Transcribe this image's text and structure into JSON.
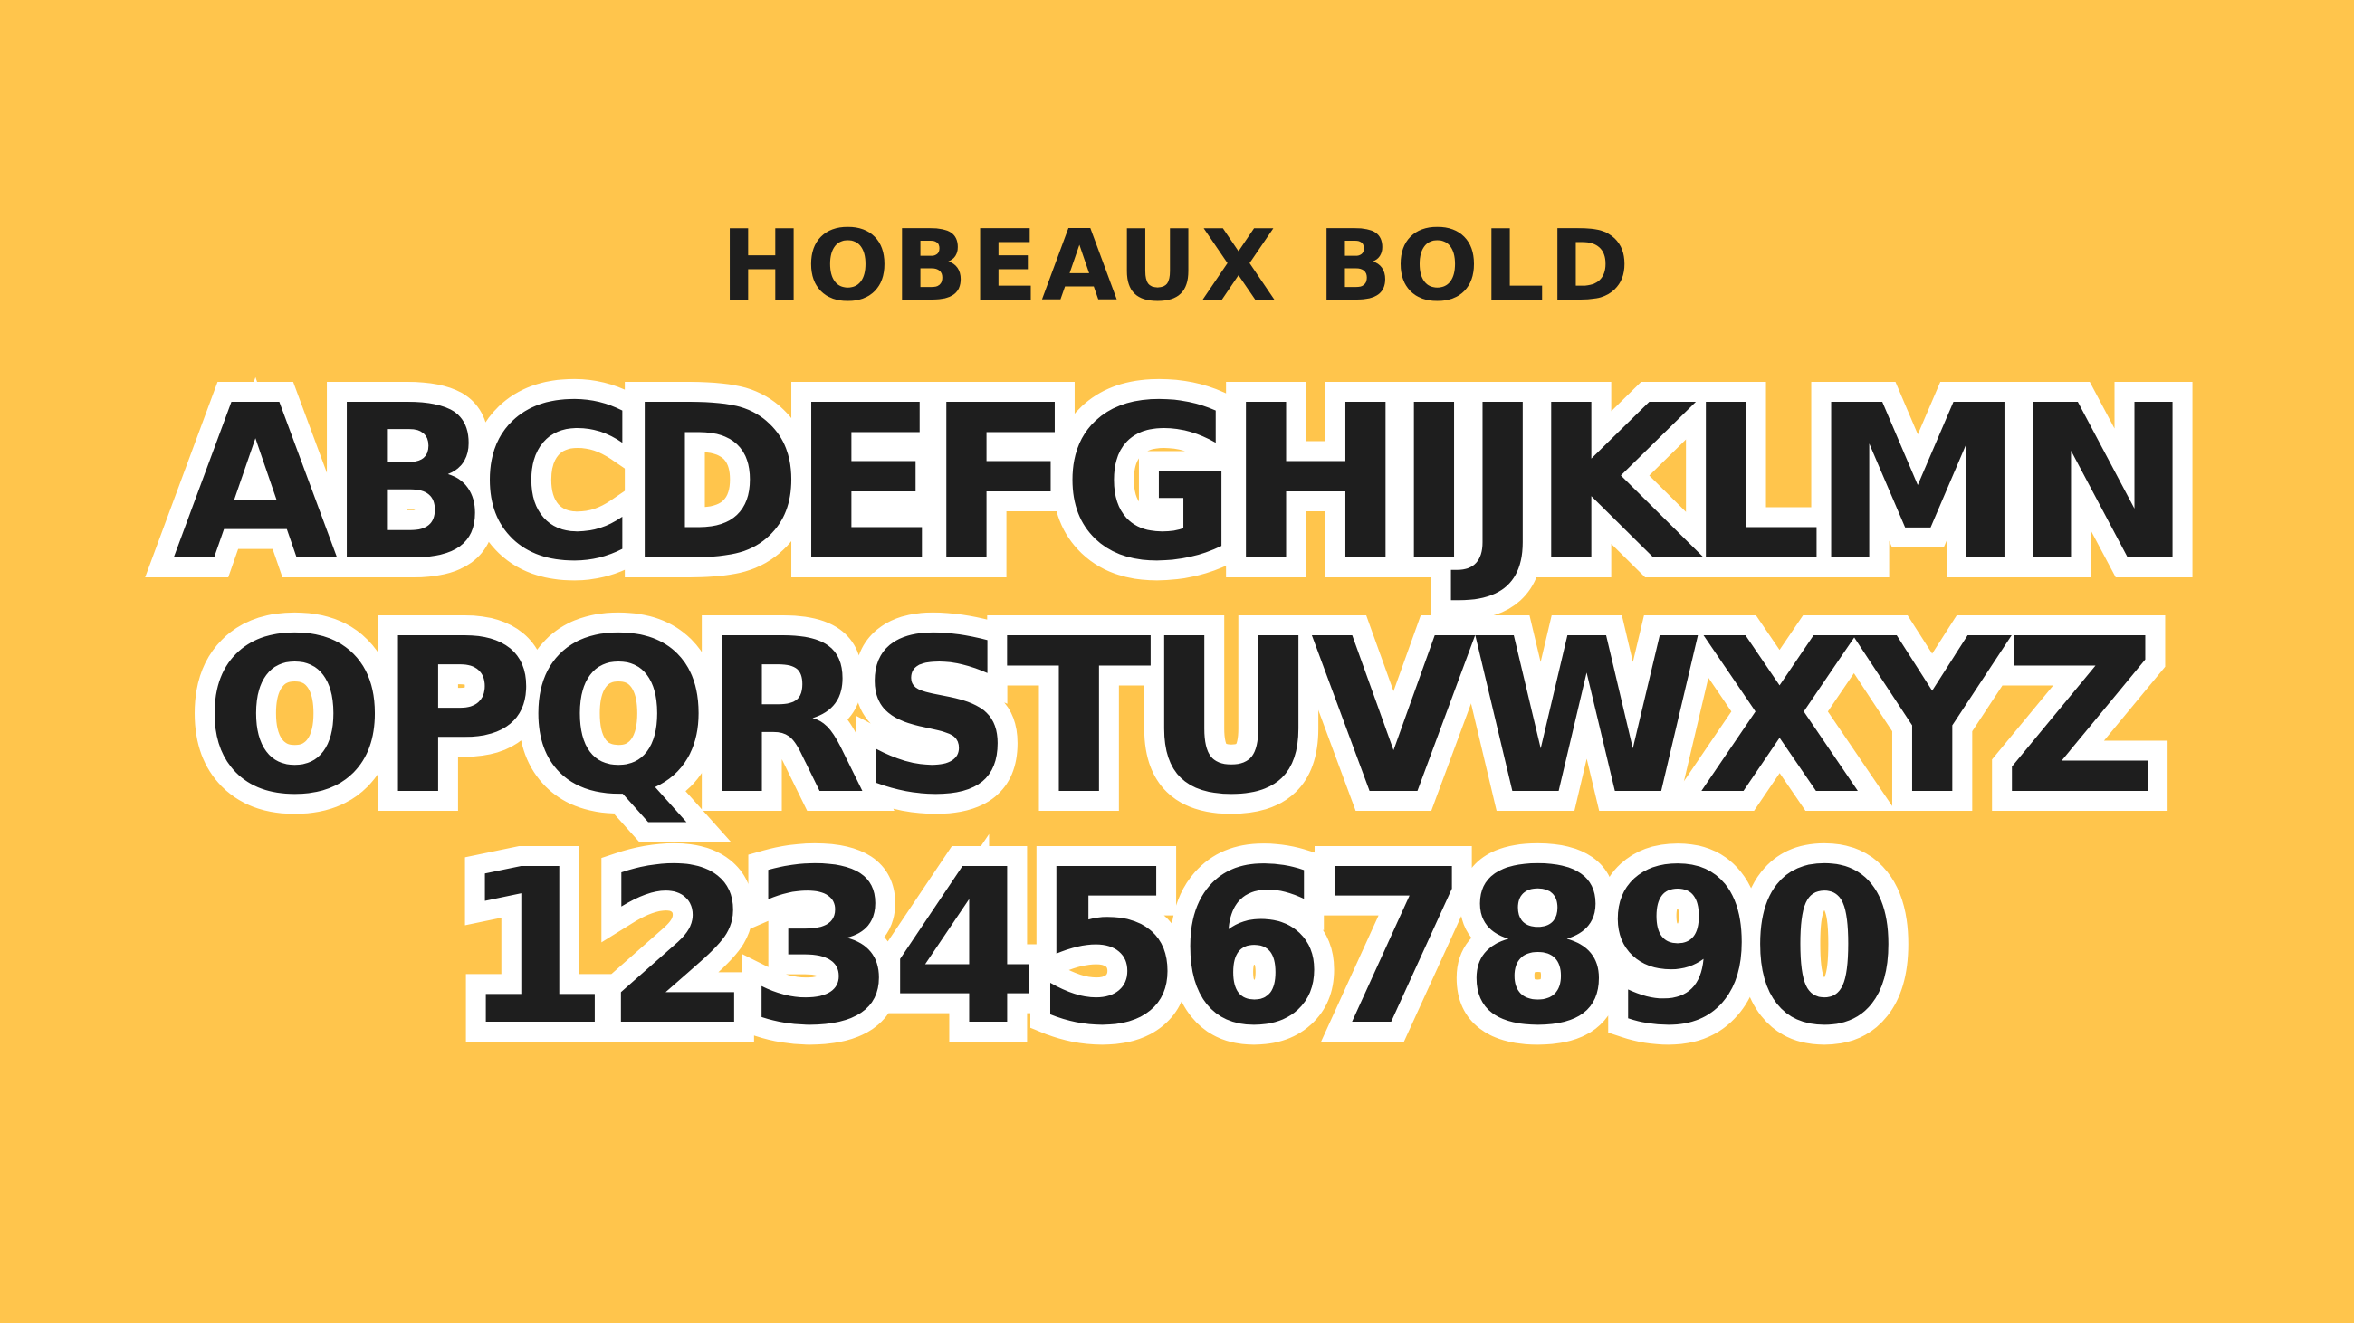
{
  "title": "HOBEAUX BOLD",
  "rows": [
    "ABCDEFGHIJKLMN",
    "OPQRSTUVWXYZ",
    "1234567890"
  ],
  "colors": {
    "background": "#FFC54C",
    "glyph_fill": "#1E1E1E",
    "glyph_outline": "#FFFFFF"
  }
}
